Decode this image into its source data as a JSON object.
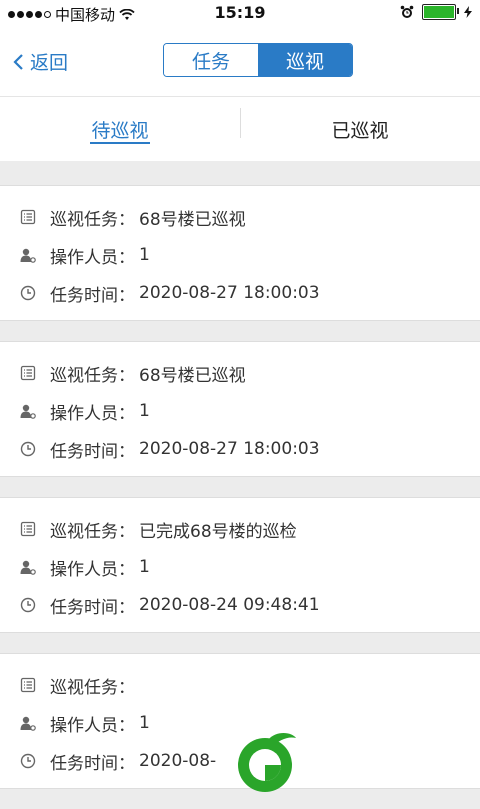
{
  "status_bar": {
    "carrier": "中国移动",
    "time": "15:19"
  },
  "nav": {
    "back_label": "返回",
    "segments": [
      "任务",
      "巡视"
    ],
    "active_segment": "巡视"
  },
  "tabs": {
    "items": [
      "待巡视",
      "已巡视"
    ],
    "active": "待巡视"
  },
  "colors": {
    "accent": "#2a7bc6",
    "battery": "#2bb52b",
    "logo_green": "#2aa52a"
  },
  "cards": [
    {
      "task_label": "巡视任务：",
      "task_value": "68号楼已巡视",
      "operator_label": "操作人员：",
      "operator_value": "1",
      "time_label": "任务时间：",
      "time_value": "2020-08-27 18:00:03"
    },
    {
      "task_label": "巡视任务：",
      "task_value": "68号楼已巡视",
      "operator_label": "操作人员：",
      "operator_value": "1",
      "time_label": "任务时间：",
      "time_value": "2020-08-27 18:00:03"
    },
    {
      "task_label": "巡视任务：",
      "task_value": "已完成68号楼的巡检",
      "operator_label": "操作人员：",
      "operator_value": "1",
      "time_label": "任务时间：",
      "time_value": "2020-08-24 09:48:41"
    },
    {
      "task_label": "巡视任务：",
      "task_value": "",
      "operator_label": "操作人员：",
      "operator_value": "1",
      "time_label": "任务时间：",
      "time_value": "2020-08-"
    }
  ],
  "icons": {
    "task": "list-icon",
    "operator": "person-icon",
    "time": "clock-icon"
  }
}
